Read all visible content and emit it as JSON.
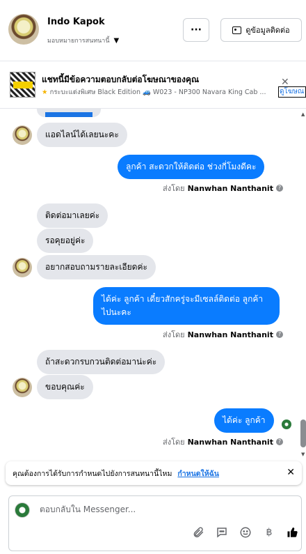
{
  "header": {
    "name": "Indo Kapok",
    "assign_label": "มอบหมายการสนทนานี้",
    "more_label": "···",
    "info_label": "ดูข้อมูลติดต่อ"
  },
  "ad": {
    "title": "แชทนี้มีข้อความตอบกลับต่อโฆษณาของคุณ",
    "subtitle": "กระบะแต่งพิเศษ Black Edition 🚙 W023 - NP300 Navara King Cab ...",
    "link": "ดูโฆษณ"
  },
  "messages": {
    "m1": "แอดไลน์ได้เลยนะคะ",
    "m2": "ลูกค้า สะดวกให้ติดต่อ ช่วงกี่โมงดีคะ",
    "m3": "ติดต่อมาเลยค่ะ",
    "m4": "รอคุยอยู่ค่ะ",
    "m5": "อยากสอบถามรายละเอียดค่ะ",
    "m6": "ได้ค่ะ  ลูกค้า เดี๋ยวสักครู่จะมีเซลล์ติดต่อ ลูกค้า ไปนะคะ",
    "m7": "ถ้าสะดวกรบกวนติดต่อมาน่ะค่ะ",
    "m8": "ขอบคุณค่ะ",
    "m9": "ได้ค่ะ  ลูกค้า"
  },
  "sent_by": {
    "prefix": "ส่งโดย",
    "name": "Nanwhan Nanthanit"
  },
  "notice": {
    "text": "คุณต้องการได้รับการกำหนดไปยังการสนทนานี้ไหม",
    "link": "กำหนดให้ฉัน"
  },
  "composer": {
    "placeholder": "ตอบกลับใน Messenger..."
  },
  "colors": {
    "outgoing": "#0a7cff",
    "incoming": "#e4e6eb",
    "link": "#1b74e4"
  }
}
